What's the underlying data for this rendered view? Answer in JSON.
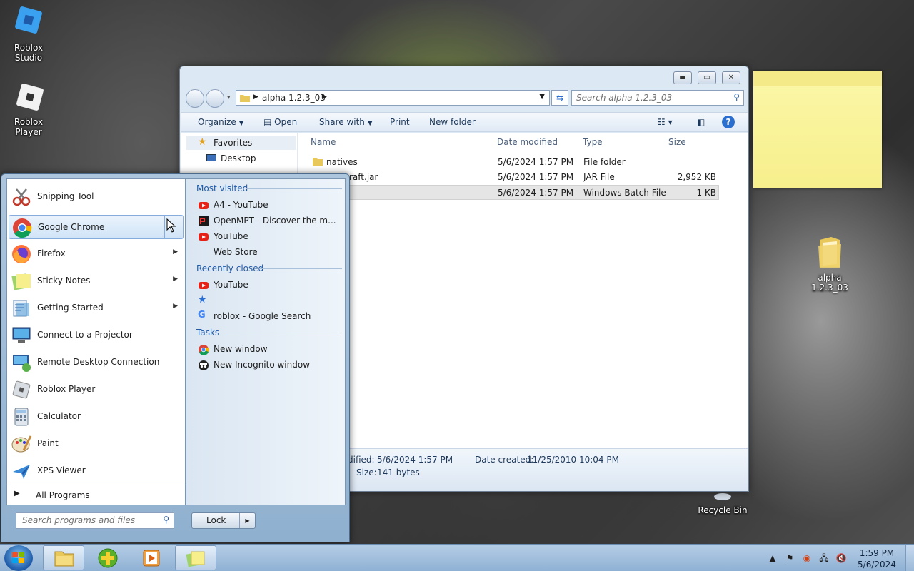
{
  "desktop": {
    "icons": [
      {
        "label": "Roblox Studio"
      },
      {
        "label": "Roblox Player"
      },
      {
        "label": "alpha 1.2.3_03"
      },
      {
        "label": "Recycle Bin"
      }
    ]
  },
  "explorer": {
    "breadcrumb": "alpha 1.2.3_03",
    "search_placeholder": "Search alpha 1.2.3_03",
    "toolbar": {
      "organize": "Organize",
      "open": "Open",
      "share_with": "Share with",
      "print": "Print",
      "new_folder": "New folder"
    },
    "nav": {
      "favorites": "Favorites",
      "desktop": "Desktop"
    },
    "columns": {
      "name": "Name",
      "date_modified": "Date modified",
      "type": "Type",
      "size": "Size"
    },
    "files": [
      {
        "name": "natives",
        "date": "5/6/2024 1:57 PM",
        "type": "File folder",
        "size": ""
      },
      {
        "name": "raft.jar",
        "date": "5/6/2024 1:57 PM",
        "type": "JAR File",
        "size": "2,952 KB"
      },
      {
        "name": "",
        "date": "5/6/2024 1:57 PM",
        "type": "Windows Batch File",
        "size": "1 KB"
      }
    ],
    "details": {
      "modified_label": "dified:",
      "modified_value": "5/6/2024 1:57 PM",
      "created_label": "Date created:",
      "created_value": "11/25/2010 10:04 PM",
      "size_label": "Size:",
      "size_value": "141 bytes"
    }
  },
  "startmenu": {
    "programs": [
      {
        "label": "Snipping Tool",
        "arrow": false
      },
      {
        "label": "Google Chrome",
        "arrow": true
      },
      {
        "label": "Firefox",
        "arrow": true
      },
      {
        "label": "Sticky Notes",
        "arrow": true
      },
      {
        "label": "Getting Started",
        "arrow": true
      },
      {
        "label": "Connect to a Projector",
        "arrow": false
      },
      {
        "label": "Remote Desktop Connection",
        "arrow": false
      },
      {
        "label": "Roblox Player",
        "arrow": false
      },
      {
        "label": "Calculator",
        "arrow": false
      },
      {
        "label": "Paint",
        "arrow": false
      },
      {
        "label": "XPS Viewer",
        "arrow": false
      }
    ],
    "all_programs": "All Programs",
    "search_placeholder": "Search programs and files",
    "lock": "Lock",
    "jumplist": {
      "most_visited_title": "Most visited",
      "most_visited": [
        "A4 - YouTube",
        "OpenMPT - Discover the m...",
        "YouTube",
        "Web Store"
      ],
      "recently_closed_title": "Recently closed",
      "recently_closed": [
        "YouTube",
        "",
        "roblox - Google Search"
      ],
      "tasks_title": "Tasks",
      "tasks": [
        "New window",
        "New Incognito window"
      ]
    }
  },
  "taskbar": {
    "time": "1:59 PM",
    "date": "5/6/2024"
  },
  "colors": {
    "accent": "#1e5aa8",
    "chrome_red": "#db4437",
    "youtube_red": "#e62117",
    "sticky_yellow": "#f8f2a0"
  }
}
